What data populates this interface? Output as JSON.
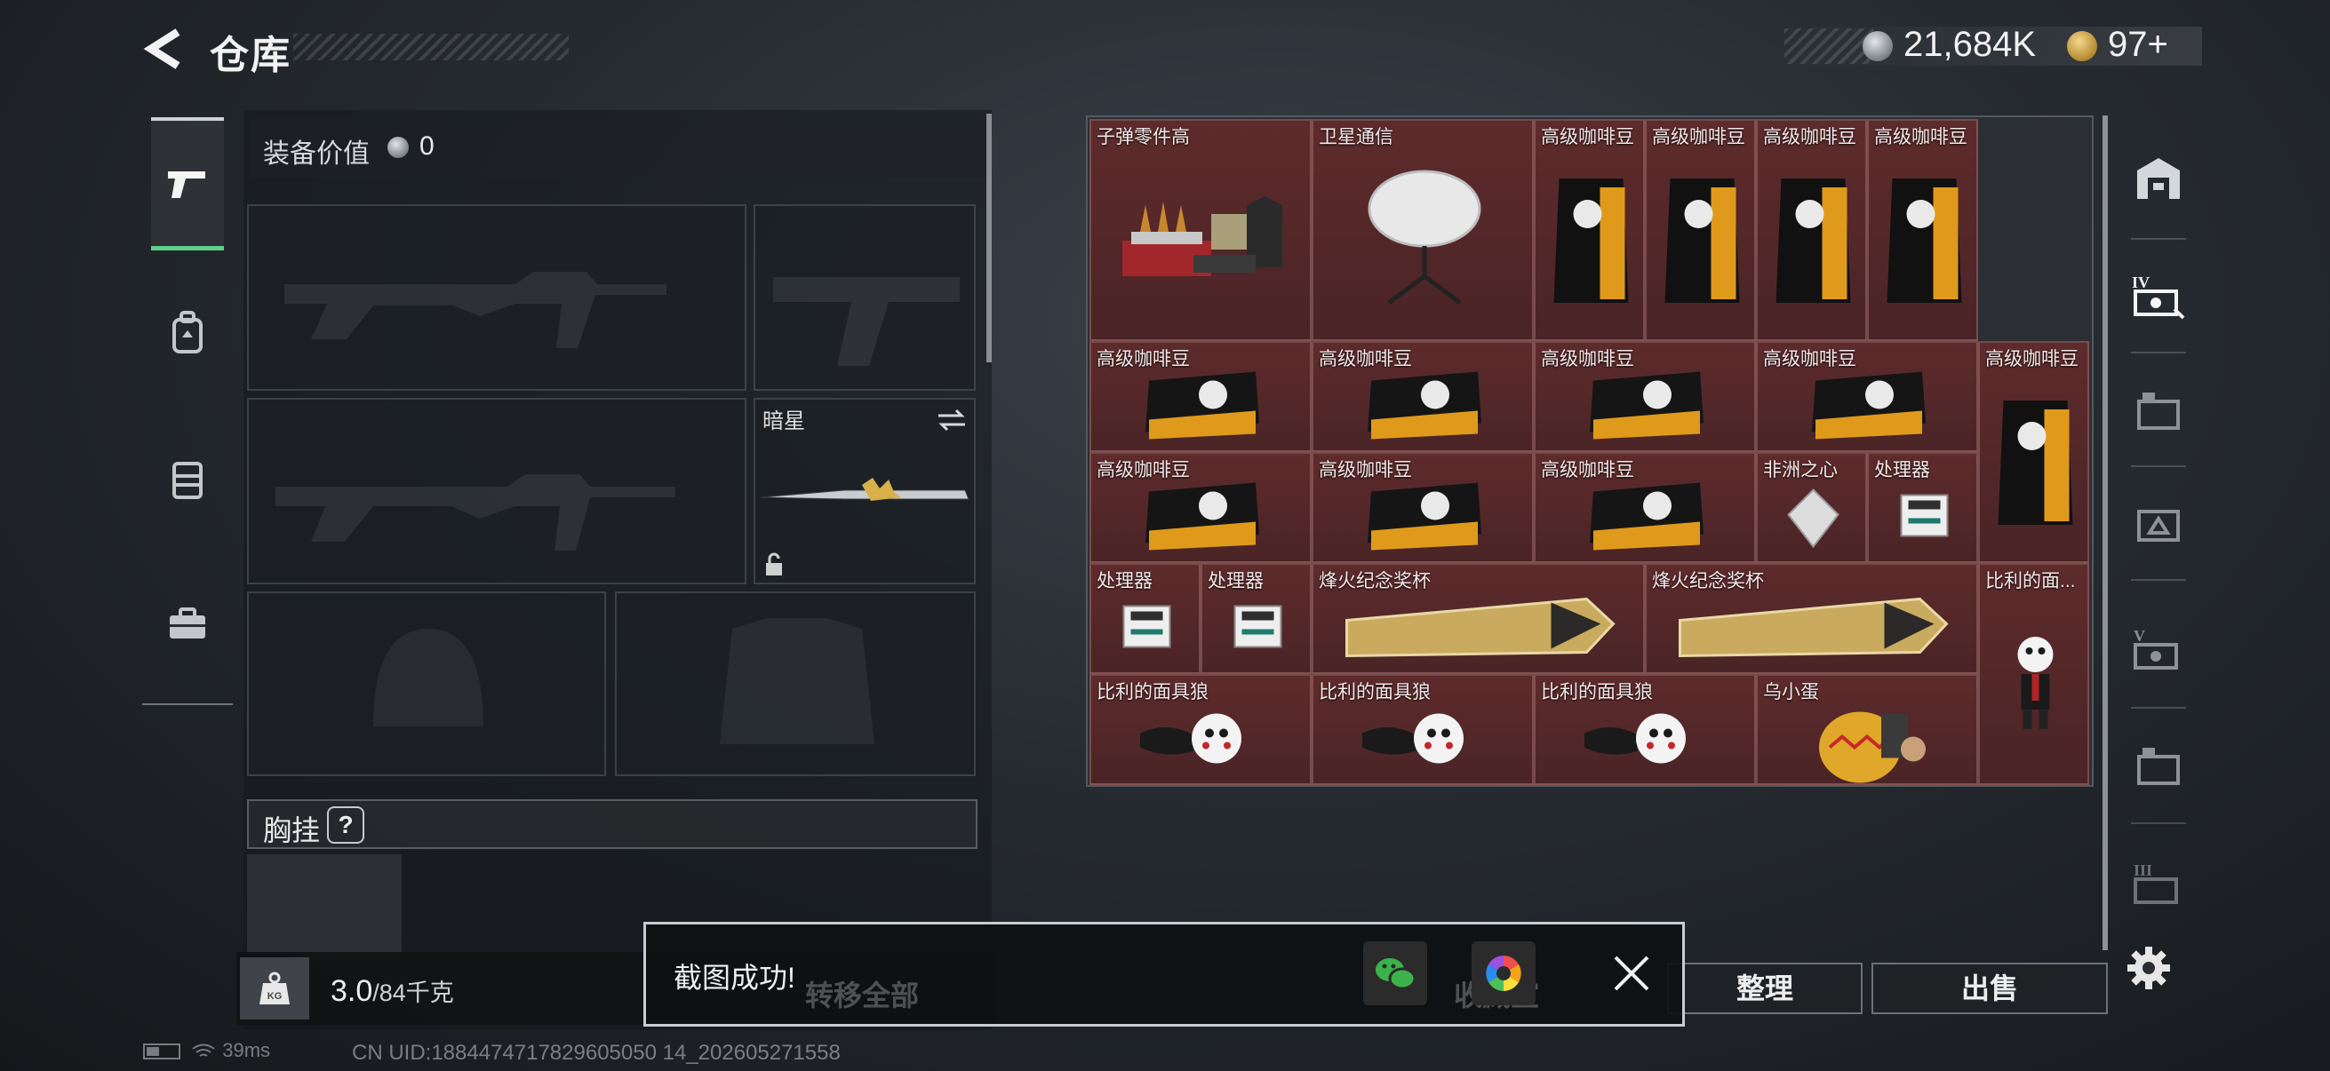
{
  "header": {
    "title": "仓库"
  },
  "currency": {
    "silver": "21,684K",
    "gold": "97+"
  },
  "nav": {
    "icons": [
      "pistol-icon",
      "backpack-icon",
      "vest-icon",
      "toolbox-icon"
    ]
  },
  "loadout": {
    "value_label": "装备价值",
    "value": "0",
    "melee_name": "暗星",
    "chest_label": "胸挂",
    "help": "?",
    "weight": "3.0",
    "weight_max": "/84千克",
    "kg_label": "KG"
  },
  "stash": {
    "items": [
      {
        "name": "子弹零件高",
        "icon": "ammo-parts-icon"
      },
      {
        "name": "卫星通信",
        "icon": "satellite-dish-icon"
      },
      {
        "name": "高级咖啡豆",
        "icon": "coffee-bag-icon"
      },
      {
        "name": "高级咖啡豆",
        "icon": "coffee-bag-icon"
      },
      {
        "name": "高级咖啡豆",
        "icon": "coffee-bag-icon"
      },
      {
        "name": "高级咖啡豆",
        "icon": "coffee-bag-icon"
      },
      {
        "name": "高级咖啡豆",
        "icon": "coffee-bag-icon"
      },
      {
        "name": "高级咖啡豆",
        "icon": "coffee-bag-icon"
      },
      {
        "name": "高级咖啡豆",
        "icon": "coffee-bag-icon"
      },
      {
        "name": "高级咖啡豆",
        "icon": "coffee-bag-icon"
      },
      {
        "name": "高级咖啡豆",
        "icon": "coffee-bag-icon"
      },
      {
        "name": "高级咖啡豆",
        "icon": "coffee-bag-icon"
      },
      {
        "name": "高级咖啡豆",
        "icon": "coffee-bag-icon"
      },
      {
        "name": "高级咖啡豆",
        "icon": "coffee-bag-icon"
      },
      {
        "name": "非洲之心",
        "icon": "diamond-icon"
      },
      {
        "name": "处理器",
        "icon": "processor-icon"
      },
      {
        "name": "处理器",
        "icon": "processor-icon"
      },
      {
        "name": "处理器",
        "icon": "processor-icon"
      },
      {
        "name": "烽火纪念奖杯",
        "icon": "trophy-icon"
      },
      {
        "name": "烽火纪念奖杯",
        "icon": "trophy-icon"
      },
      {
        "name": "比利的面...",
        "icon": "puppet-icon"
      },
      {
        "name": "比利的面具狼",
        "icon": "puppet-icon"
      },
      {
        "name": "比利的面具狼",
        "icon": "puppet-icon"
      },
      {
        "name": "比利的面具狼",
        "icon": "puppet-icon"
      },
      {
        "name": "乌小蛋",
        "icon": "egg-icon"
      }
    ]
  },
  "side_tabs": [
    "home-shelf-icon",
    "stash-iv-icon",
    "stash-tab-icon",
    "stash-tab-icon",
    "stash-v-icon",
    "stash-tab-icon",
    "stash-iii-icon"
  ],
  "actions": {
    "transfer_all": "转移全部",
    "collect": "收藏室",
    "sort": "整理",
    "sell": "出售"
  },
  "toast": {
    "message": "截图成功!"
  },
  "status": {
    "ping": "39ms",
    "uid": "CN UID:1884474717829605050 14_202605271558"
  },
  "colors": {
    "accent_green": "#5fd08a",
    "stash_red": "#5e2b2c"
  }
}
